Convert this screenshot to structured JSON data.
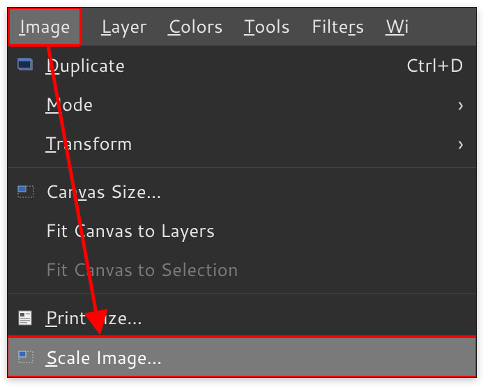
{
  "menubar": {
    "image": "Image",
    "layer": "Layer",
    "colors": "Colors",
    "tools": "Tools",
    "filters": "Filters",
    "windows": "Wi"
  },
  "dropdown": {
    "duplicate": {
      "label": "Duplicate",
      "shortcut": "Ctrl+D"
    },
    "mode": "Mode",
    "transform": "Transform",
    "canvas_size": "Canvas Size...",
    "fit_layers": "Fit Canvas to Layers",
    "fit_selection": "Fit Canvas to Selection",
    "print_size": "Print Size...",
    "scale_image": "Scale Image..."
  },
  "highlight_colors": {
    "annotation": "#ff0000"
  }
}
